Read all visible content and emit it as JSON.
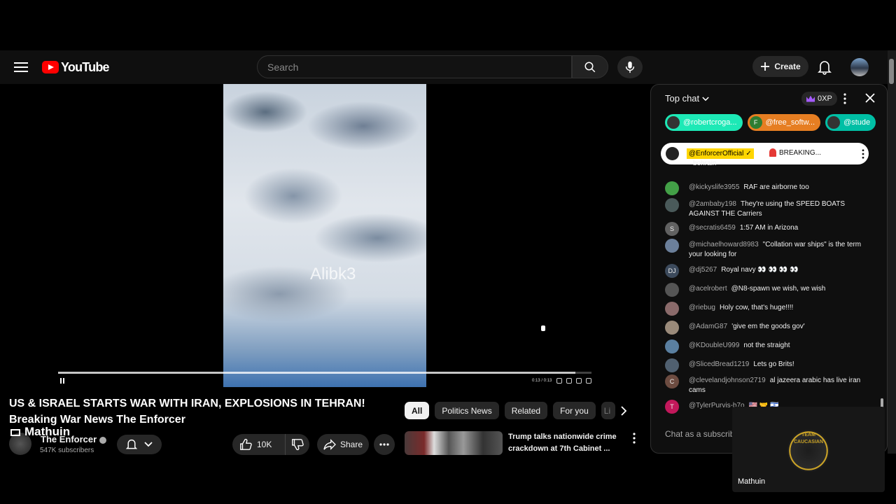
{
  "header": {
    "logo_text": "YouTube",
    "search_placeholder": "Search",
    "create_label": "Create"
  },
  "player": {
    "watermark": "Alibk3",
    "time_display": "0:13 / 0:13",
    "progress_fraction": 0.97
  },
  "video": {
    "title_line1": "US & ISRAEL STARTS WAR WITH IRAN, EXPLOSIONS IN TEHRAN!",
    "title_line2": "Breaking War News The Enforcer",
    "channel_name": "The Enforcer",
    "subscribers": "547K subscribers",
    "overlay_name": "Mathuin",
    "like_count": "10K",
    "share_label": "Share"
  },
  "chips": [
    {
      "label": "All"
    },
    {
      "label": "Politics News"
    },
    {
      "label": "Related"
    },
    {
      "label": "For you"
    },
    {
      "label": "Li"
    }
  ],
  "recommendation": {
    "title": "Trump talks nationwide crime crackdown at 7th Cabinet ..."
  },
  "chat": {
    "mode_label": "Top chat",
    "xp_label": "0XP",
    "tickers": [
      {
        "name": "@robertcroga...",
        "color": "#1de9b6",
        "initial": ""
      },
      {
        "name": "@free_softw...",
        "color": "#e67e22",
        "initial": "F"
      },
      {
        "name": "@stude",
        "color": "#00bfa5",
        "initial": ""
      }
    ],
    "pinned": {
      "author": "@EnforcerOfficial",
      "text": "BREAKING..."
    },
    "messages": [
      {
        "author": "",
        "text": "bohrain",
        "avatar_color": "#444",
        "initial": ""
      },
      {
        "author": "@kickyslife3955",
        "text": "RAF are airborne too",
        "avatar_color": "#43a047",
        "initial": ""
      },
      {
        "author": "@2ambaby198",
        "text": "They're using the SPEED BOATS AGAINST THE Carriers",
        "avatar_color": "#4a5a5a",
        "initial": ""
      },
      {
        "author": "@secratis6459",
        "text": "1:57 AM in Arizona",
        "avatar_color": "#616161",
        "initial": "S"
      },
      {
        "author": "@michaelhoward8983",
        "text": "\"Collation war ships\" is the term your looking for",
        "avatar_color": "#6b7f9a",
        "initial": ""
      },
      {
        "author": "@dj5267",
        "text": "Royal navy 👀 👀 👀 👀",
        "avatar_color": "#3c4a5c",
        "initial": "DJ"
      },
      {
        "author": "@acelrobert",
        "text": "@N8-spawn we wish, we wish",
        "avatar_color": "#555",
        "initial": ""
      },
      {
        "author": "@riebug",
        "text": "Holy cow, that's huge!!!!",
        "avatar_color": "#8a6a6a",
        "initial": ""
      },
      {
        "author": "@AdamG87",
        "text": "'give em the goods gov'",
        "avatar_color": "#9a8a7a",
        "initial": ""
      },
      {
        "author": "@KDoubleU999",
        "text": "not the straight",
        "avatar_color": "#5a7fa0",
        "initial": ""
      },
      {
        "author": "@SlicedBread1219",
        "text": "Lets go Brits!",
        "avatar_color": "#506070",
        "initial": ""
      },
      {
        "author": "@clevelandjohnson2719",
        "text": "al jazeera arabic has live iran cams",
        "avatar_color": "#6d4c41",
        "initial": "C"
      },
      {
        "author": "@TylerPurvis-b7o",
        "text": "🇺🇸 🤝 🇮🇱",
        "avatar_color": "#c2185b",
        "initial": "T"
      }
    ],
    "input_placeholder": "Chat as a subscriber..."
  },
  "webcam": {
    "badge_text": "TEAM CAUCASIAN",
    "name": "Mathuin"
  }
}
